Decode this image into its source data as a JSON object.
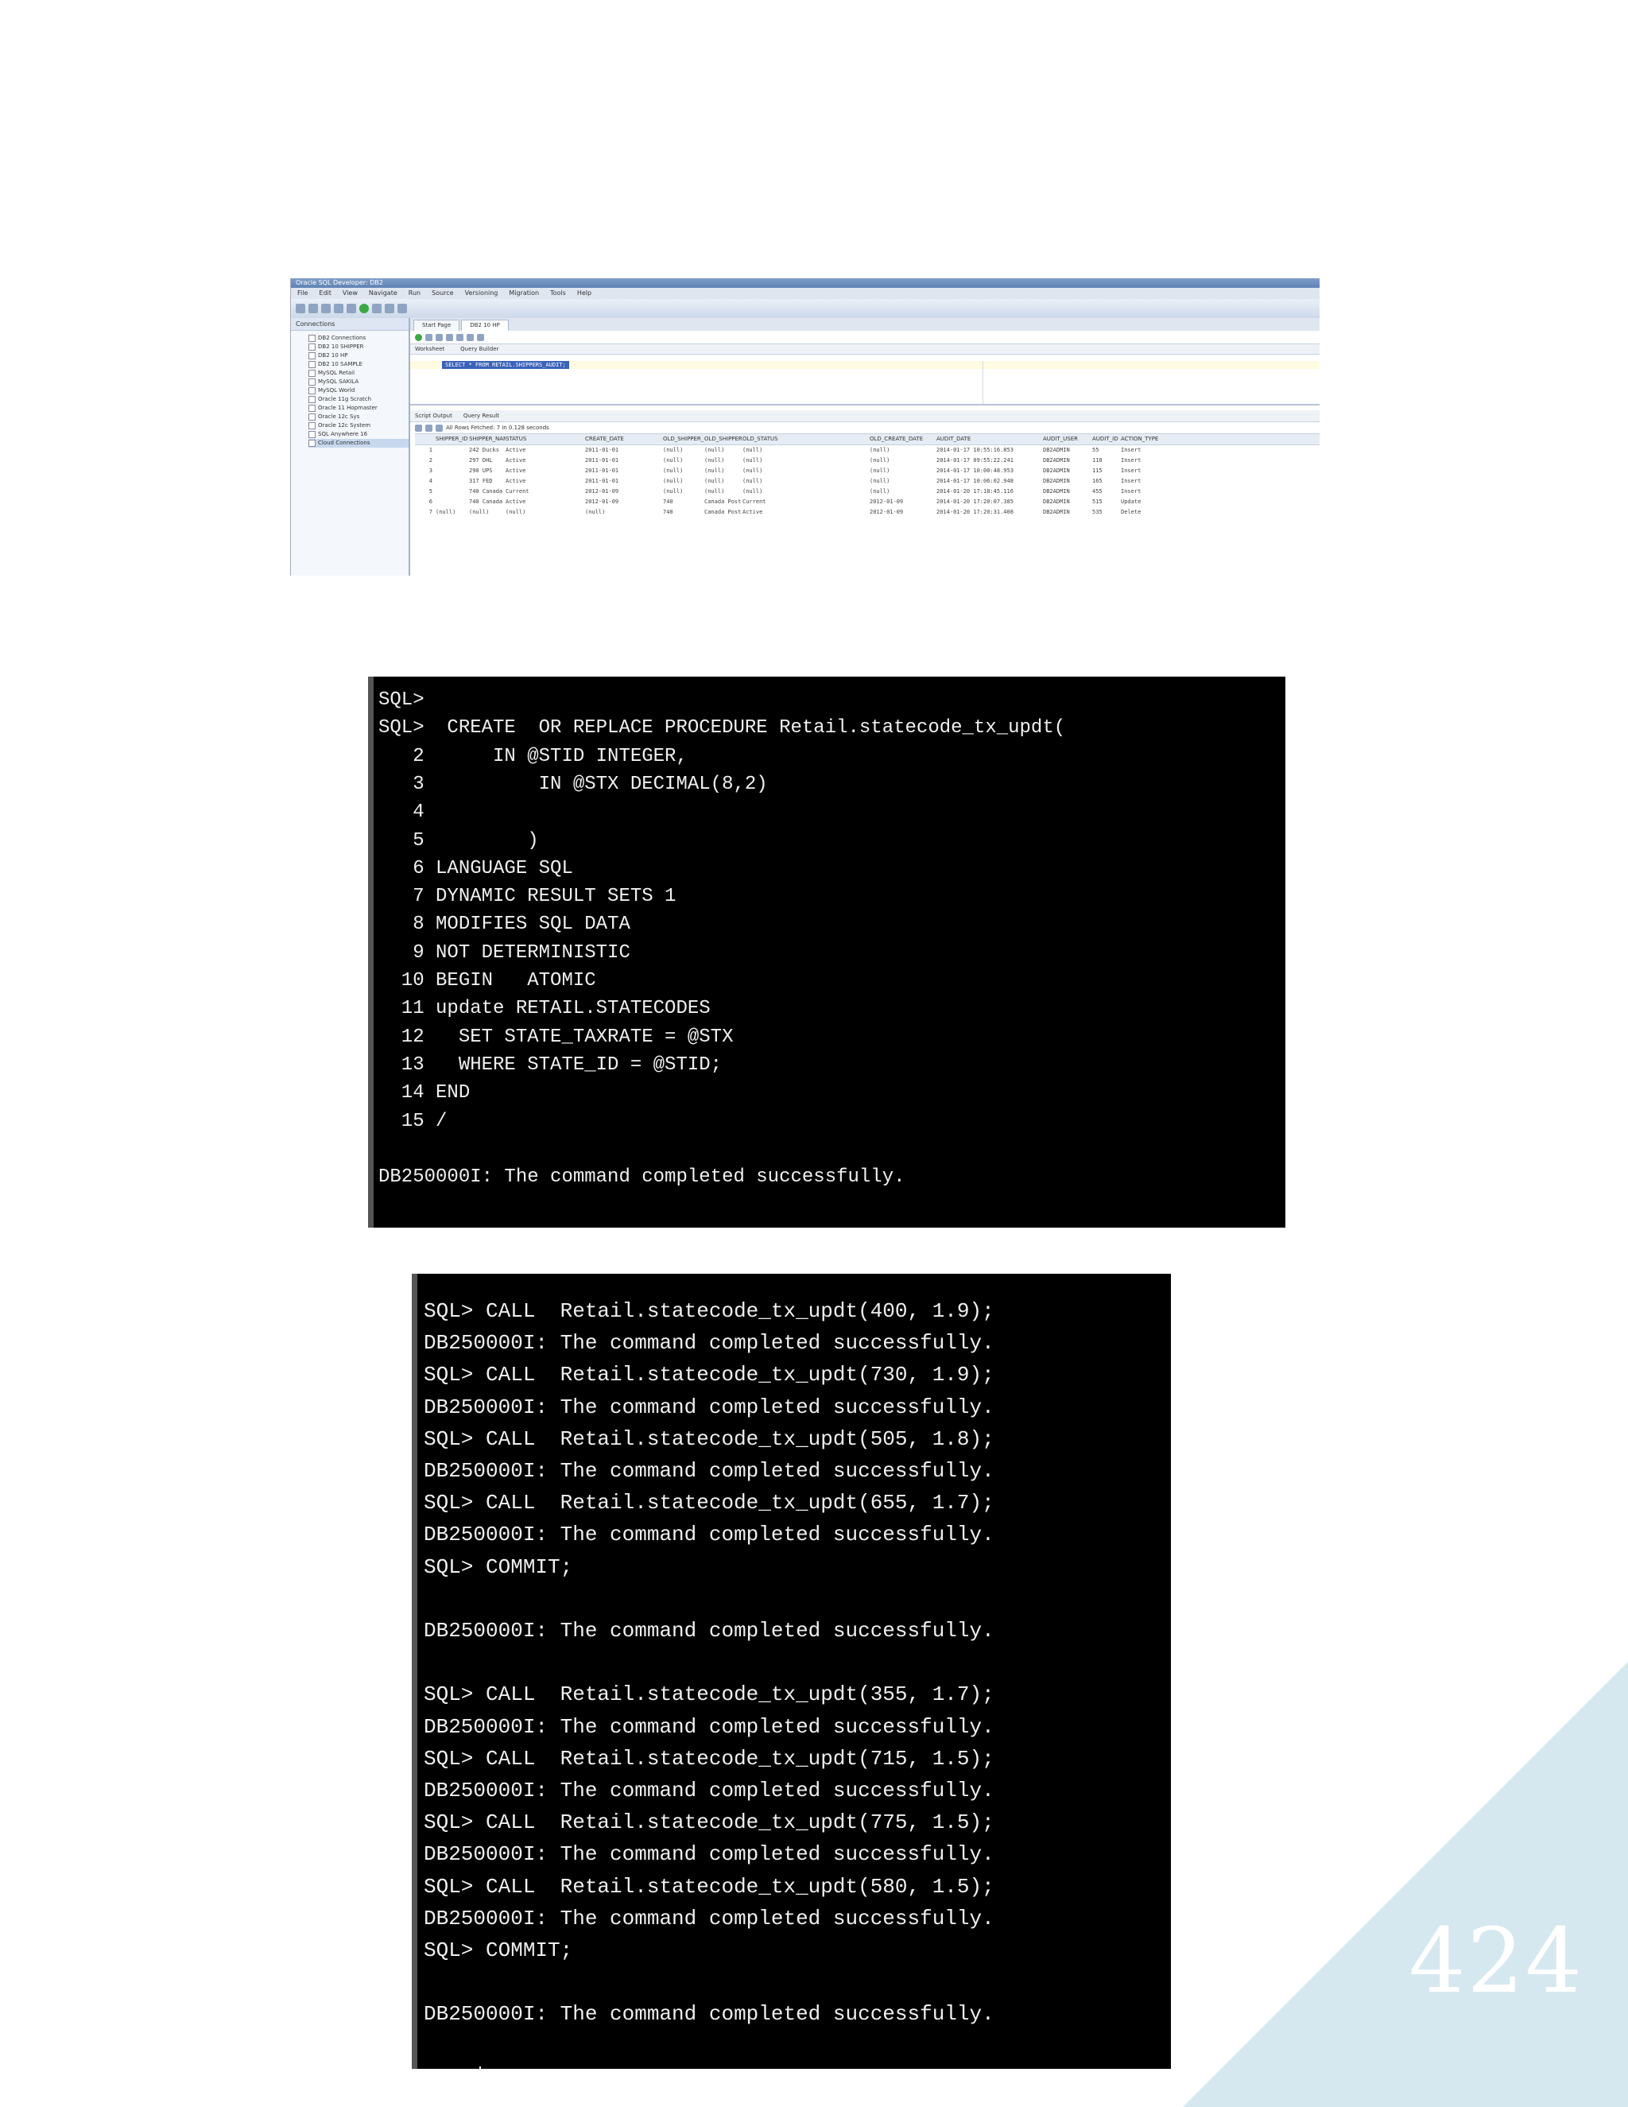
{
  "page_number": "424",
  "ide": {
    "title": "Oracle SQL Developer: DB2",
    "menu": [
      "File",
      "Edit",
      "View",
      "Navigate",
      "Run",
      "Source",
      "Versioning",
      "Migration",
      "Tools",
      "Help"
    ],
    "connections_title": "Connections",
    "tree_items": [
      "DB2 Connections",
      "DB2 10 SHIPPER",
      "DB2 10 HP",
      "DB2 10 SAMPLE",
      "MySQL Retail",
      "MySQL SAKILA",
      "MySQL World",
      "Oracle 11g Scratch",
      "Oracle 11 Hopmaster",
      "Oracle 12c Sys",
      "Oracle 12c System",
      "SQL Anywhere 16",
      "Cloud Connections"
    ],
    "tabs": [
      "Start Page",
      "DB2 10 HP"
    ],
    "subtabs": [
      "Worksheet",
      "Query Builder"
    ],
    "query_text": "SELECT * FROM RETAIL.SHIPPERS_AUDIT;",
    "output_tabs": [
      "Script Output",
      "Query Result"
    ],
    "fetch_status": "All Rows Fetched: 7 in 0.128 seconds",
    "grid": {
      "headers": [
        "",
        "SHIPPER_ID",
        "SHIPPER_NAME",
        "STATUS",
        "CREATE_DATE",
        "OLD_SHIPPER_ID",
        "OLD_SHIPPER_NAME",
        "OLD_STATUS",
        "OLD_CREATE_DATE",
        "AUDIT_DATE",
        "AUDIT_USER",
        "AUDIT_ID",
        "ACTION_TYPE"
      ],
      "rows": [
        [
          "1",
          "",
          "242 Ducks",
          "Active",
          "2011-01-01",
          "(null)",
          "(null)",
          "(null)",
          "(null)",
          "2014-01-17 10:55:16.853",
          "DB2ADMIN",
          "55",
          "Insert"
        ],
        [
          "2",
          "",
          "297 DHL",
          "Active",
          "2011-01-01",
          "(null)",
          "(null)",
          "(null)",
          "(null)",
          "2014-01-17 09:55:22.241",
          "DB2ADMIN",
          "110",
          "Insert"
        ],
        [
          "3",
          "",
          "290 UPS",
          "Active",
          "2011-01-01",
          "(null)",
          "(null)",
          "(null)",
          "(null)",
          "2014-01-17 10:00:48.953",
          "DB2ADMIN",
          "115",
          "Insert"
        ],
        [
          "4",
          "",
          "317 FED",
          "Active",
          "2011-01-01",
          "(null)",
          "(null)",
          "(null)",
          "(null)",
          "2014-01-17 10:06:02.948",
          "DB2ADMIN",
          "165",
          "Insert"
        ],
        [
          "5",
          "",
          "740 Canada Post",
          "Current",
          "2012-01-09",
          "(null)",
          "(null)",
          "(null)",
          "(null)",
          "2014-01-20 17:18:45.116",
          "DB2ADMIN",
          "455",
          "Insert"
        ],
        [
          "6",
          "",
          "740 Canada Post",
          "Active",
          "2012-01-09",
          "740",
          "Canada Post",
          "Current",
          "2012-01-09",
          "2014-01-20 17:20:07.385",
          "DB2ADMIN",
          "515",
          "Update"
        ],
        [
          "7",
          "(null)",
          "(null)",
          "(null)",
          "(null)",
          "740",
          "Canada Post",
          "Active",
          "2012-01-09",
          "2014-01-20 17:20:31.408",
          "DB2ADMIN",
          "535",
          "Delete"
        ]
      ]
    }
  },
  "terminal1": {
    "lines": [
      "SQL>",
      "SQL>  CREATE  OR REPLACE PROCEDURE Retail.statecode_tx_updt(",
      "   2      IN @STID INTEGER,",
      "   3          IN @STX DECIMAL(8,2)",
      "   4",
      "   5         )",
      "   6 LANGUAGE SQL",
      "   7 DYNAMIC RESULT SETS 1",
      "   8 MODIFIES SQL DATA",
      "   9 NOT DETERMINISTIC",
      "  10 BEGIN   ATOMIC",
      "  11 update RETAIL.STATECODES",
      "  12   SET STATE_TAXRATE = @STX",
      "  13   WHERE STATE_ID = @STID;",
      "  14 END",
      "  15 /",
      "",
      "DB250000I: The command completed successfully."
    ]
  },
  "terminal2": {
    "lines": [
      "SQL> CALL  Retail.statecode_tx_updt(400, 1.9);",
      "DB250000I: The command completed successfully.",
      "SQL> CALL  Retail.statecode_tx_updt(730, 1.9);",
      "DB250000I: The command completed successfully.",
      "SQL> CALL  Retail.statecode_tx_updt(505, 1.8);",
      "DB250000I: The command completed successfully.",
      "SQL> CALL  Retail.statecode_tx_updt(655, 1.7);",
      "DB250000I: The command completed successfully.",
      "SQL> COMMIT;",
      "",
      "DB250000I: The command completed successfully.",
      "",
      "SQL> CALL  Retail.statecode_tx_updt(355, 1.7);",
      "DB250000I: The command completed successfully.",
      "SQL> CALL  Retail.statecode_tx_updt(715, 1.5);",
      "DB250000I: The command completed successfully.",
      "SQL> CALL  Retail.statecode_tx_updt(775, 1.5);",
      "DB250000I: The command completed successfully.",
      "SQL> CALL  Retail.statecode_tx_updt(580, 1.5);",
      "DB250000I: The command completed successfully.",
      "SQL> COMMIT;",
      "",
      "DB250000I: The command completed successfully.",
      "",
      "SQL>"
    ]
  }
}
